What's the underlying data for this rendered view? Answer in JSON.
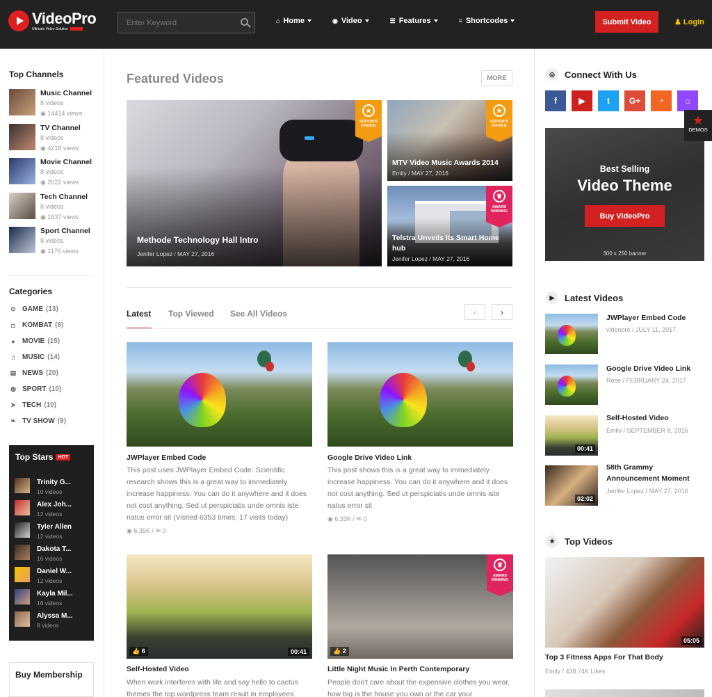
{
  "header": {
    "logo_name": "VideoPro",
    "logo_tagline": "Ultimate Video Solution",
    "search_placeholder": "Enter Keyword",
    "nav": [
      {
        "label": "Home",
        "icon": "home-icon"
      },
      {
        "label": "Video",
        "icon": "play-circle-icon"
      },
      {
        "label": "Features",
        "icon": "menu-icon"
      },
      {
        "label": "Shortcodes",
        "icon": "database-icon"
      }
    ],
    "submit_label": "Submit Video",
    "login_label": "Login",
    "colors": {
      "bg": "#222222",
      "accent": "#d32020",
      "login": "#f5c400"
    }
  },
  "left": {
    "channels_title": "Top Channels",
    "channels": [
      {
        "name": "Music Channel",
        "videos": "8 videos",
        "views": "14414 views"
      },
      {
        "name": "TV Channel",
        "videos": "8 videos",
        "views": "4218 views"
      },
      {
        "name": "Movie Channel",
        "videos": "8 videos",
        "views": "2022 views"
      },
      {
        "name": "Tech Channel",
        "videos": "8 videos",
        "views": "1637 views"
      },
      {
        "name": "Sport Channel",
        "videos": "8 videos",
        "views": "1176 views"
      }
    ],
    "categories_title": "Categories",
    "categories": [
      {
        "name": "GAME",
        "count": "(13)",
        "icon": "gamepad-icon"
      },
      {
        "name": "KOMBAT",
        "count": "(8)",
        "icon": "shield-icon"
      },
      {
        "name": "MOVIE",
        "count": "(15)",
        "icon": "play-circle-icon"
      },
      {
        "name": "MUSIC",
        "count": "(14)",
        "icon": "music-icon"
      },
      {
        "name": "NEWS",
        "count": "(20)",
        "icon": "newspaper-icon"
      },
      {
        "name": "SPORT",
        "count": "(10)",
        "icon": "soccer-ball-icon"
      },
      {
        "name": "TECH",
        "count": "(10)",
        "icon": "send-icon"
      },
      {
        "name": "TV SHOW",
        "count": "(9)",
        "icon": "leaf-icon"
      }
    ],
    "stars_title": "Top Stars",
    "hot_label": "HOT",
    "stars": [
      {
        "name": "Trinity G...",
        "videos": "10 videos"
      },
      {
        "name": "Alex Joh...",
        "videos": "12 videos"
      },
      {
        "name": "Tyler Allen",
        "videos": "12 videos"
      },
      {
        "name": "Dakota T...",
        "videos": "16 videos"
      },
      {
        "name": "Daniel W...",
        "videos": "12 videos"
      },
      {
        "name": "Kayla Mil...",
        "videos": "16 videos"
      },
      {
        "name": "Alyssa M...",
        "videos": "8 videos"
      }
    ],
    "membership_title": "Buy Membership"
  },
  "main": {
    "featured_title": "Featured Videos",
    "more_label": "MORE",
    "featured": [
      {
        "title": "Methode Technology Hall Intro",
        "author": "Jenifer Lopez",
        "date": "MAY 27, 2016",
        "badge": "EDITOR'S CHOICE"
      },
      {
        "title": "MTV Video Music Awards 2014",
        "author": "Emily",
        "date": "MAY 27, 2016",
        "badge": "EDITOR'S CHOICE"
      },
      {
        "title": "Telstra Unveils Its Smart Home hub",
        "author": "Jenifer Lopez",
        "date": "MAY 27, 2016",
        "badge": "AWARD WINNING"
      }
    ],
    "tabs": [
      "Latest",
      "Top Viewed",
      "See All Videos"
    ],
    "videos": [
      {
        "title": "JWPlayer Embed Code",
        "desc": "This post uses JWPlayer Embed Code. Scientific research shows this is a great way to immediately increase happiness. You can do it anywhere and it does not cost anything. Sed ut perspiciatis unde omnis iste natus error sit (Visited 6353 times, 17 visits today)",
        "views": "6.35K",
        "comments": "0"
      },
      {
        "title": "Google Drive Video Link",
        "desc": "This post shows this is a great way to immediately increase happiness. You can do it anywhere and it does not cost anything. Sed ut perspiciatis unde omnis iste natus error sit",
        "views": "6.33K",
        "comments": "0"
      },
      {
        "title": "Self-Hosted Video",
        "desc": "When work interferes with life and say hello to cactus themes the top wordpress team result in employees",
        "likes": "6",
        "duration": "00:41"
      },
      {
        "title": "Night Music In Perth Contemporary",
        "desc": "People don't care about the expensive clothes you wear, how big is the house you own or the car your",
        "likes": "2",
        "badge": "AWARD WINNING"
      }
    ]
  },
  "right": {
    "connect_title": "Connect With Us",
    "social": [
      {
        "name": "facebook-icon",
        "glyph": "f",
        "color": "#3b5998"
      },
      {
        "name": "youtube-icon",
        "glyph": "▶",
        "color": "#cd201f"
      },
      {
        "name": "twitter-icon",
        "glyph": "t",
        "color": "#1da1f2"
      },
      {
        "name": "google-plus-icon",
        "glyph": "G+",
        "color": "#dd4b39"
      },
      {
        "name": "rss-icon",
        "glyph": "◔",
        "color": "#f26522"
      },
      {
        "name": "twitch-icon",
        "glyph": "⌂",
        "color": "#9146ff"
      }
    ],
    "banner": {
      "sub": "Best Selling",
      "main": "Video Theme",
      "button": "Buy VideoPro",
      "size": "300 x 250 banner"
    },
    "demos_label": "DEMOS",
    "latest_title": "Latest Videos",
    "latest": [
      {
        "title": "JWPlayer Embed Code",
        "author": "videopro",
        "date": "JULY 11, 2017",
        "duration": ""
      },
      {
        "title": "Google Drive Video Link",
        "author": "Rose",
        "date": "FEBRUARY 24, 2017",
        "duration": ""
      },
      {
        "title": "Self-Hosted Video",
        "author": "Emily",
        "date": "SEPTEMBER 8, 2016",
        "duration": "00:41"
      },
      {
        "title": "58th Grammy Announcement Moment",
        "author": "Jenifer Lopez",
        "date": "MAY 27, 2016",
        "duration": "02:02"
      }
    ],
    "top_title": "Top Videos",
    "top": {
      "title": "Top 3 Fitness Apps For That Body",
      "author": "Emily",
      "likes": "438.74K Likes",
      "duration": "05:05"
    }
  }
}
